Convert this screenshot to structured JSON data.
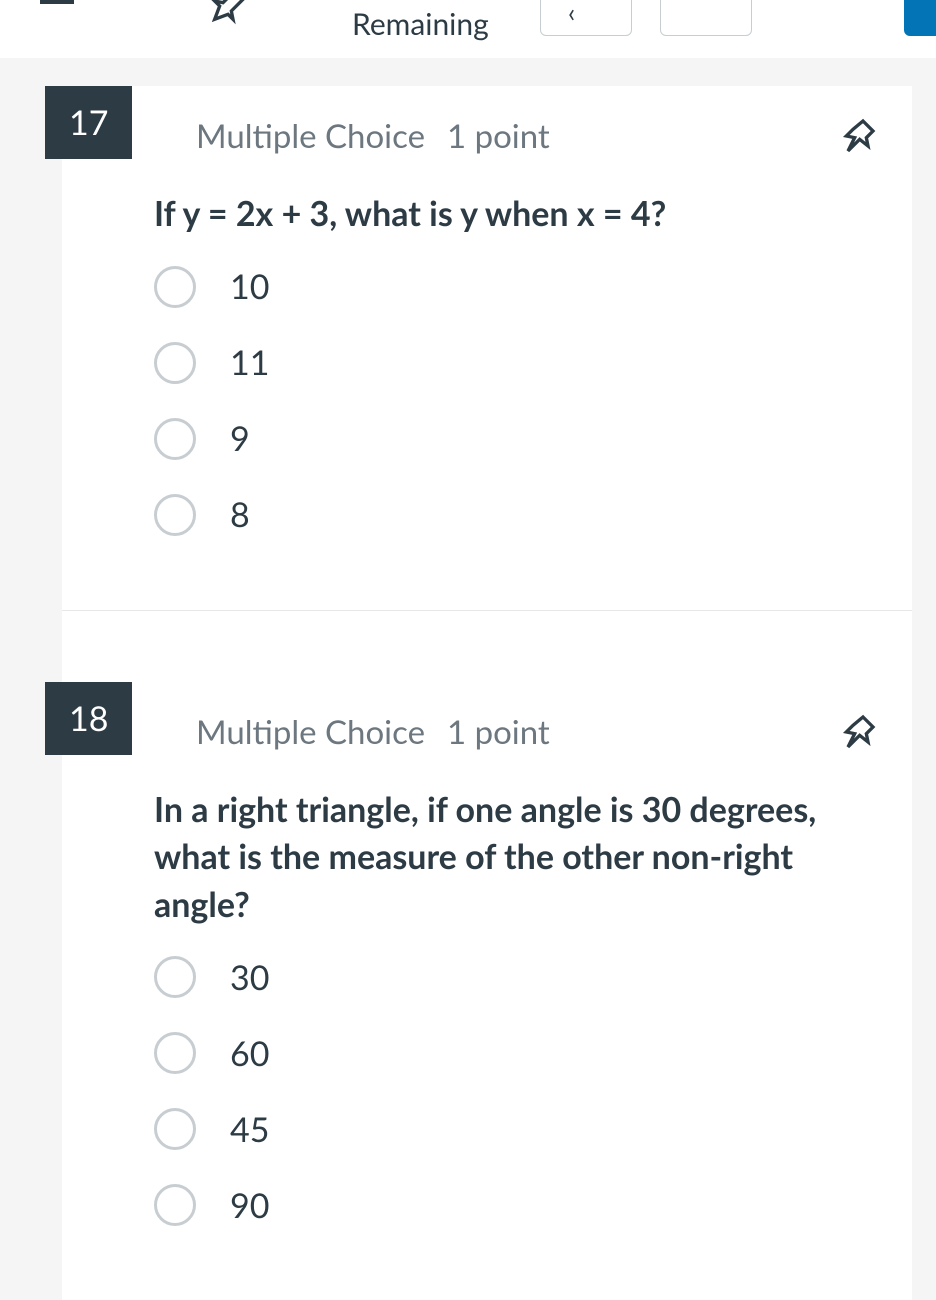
{
  "topbar": {
    "remaining_label": "Remaining"
  },
  "questions": [
    {
      "number": "17",
      "type": "Multiple Choice",
      "points": "1 point",
      "text": "If y = 2x + 3, what is y when x = 4?",
      "options": [
        "10",
        "11",
        "9",
        "8"
      ]
    },
    {
      "number": "18",
      "type": "Multiple Choice",
      "points": "1 point",
      "text": "In a right triangle, if one angle is 30 degrees, what is the measure of the other non-right angle?",
      "options": [
        "30",
        "60",
        "45",
        "90"
      ]
    }
  ]
}
